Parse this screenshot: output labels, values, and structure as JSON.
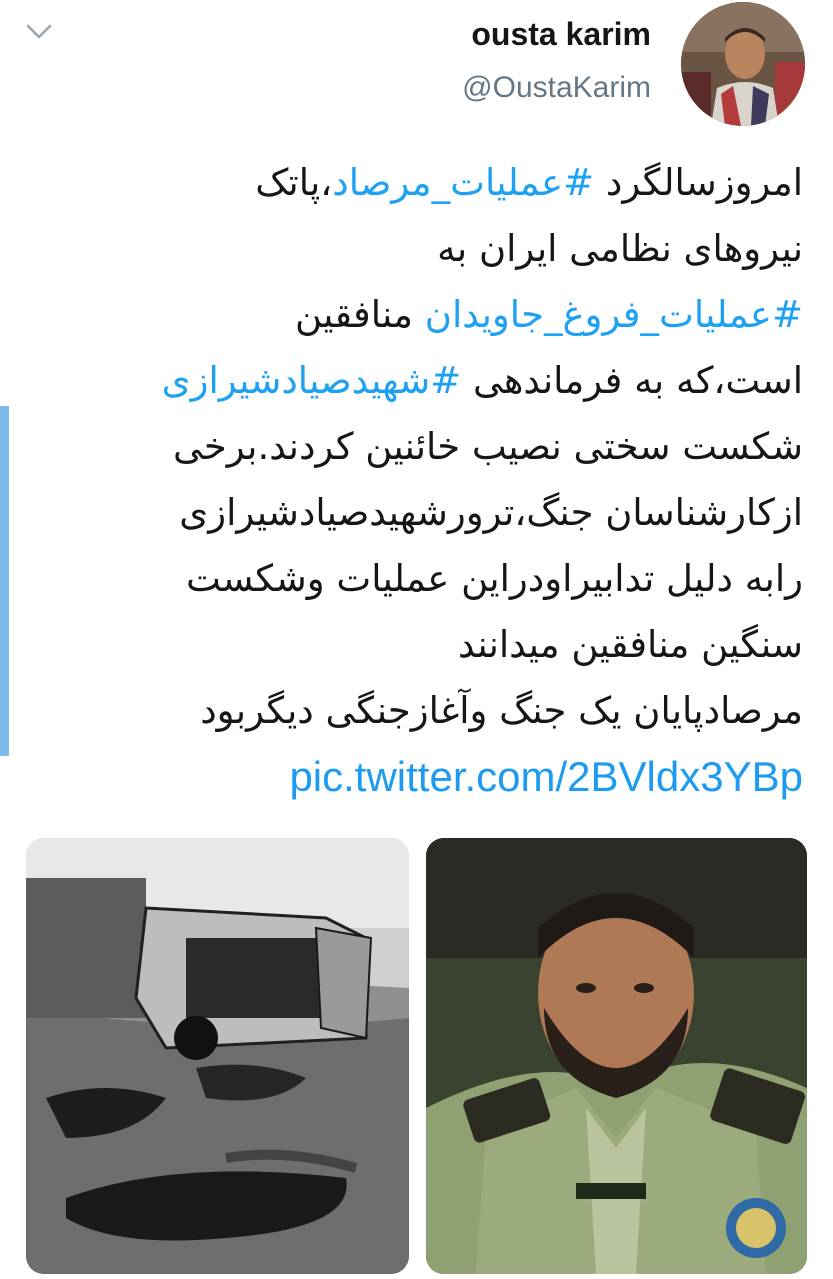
{
  "header": {
    "display_name": "ousta karim",
    "handle": "@OustaKarim",
    "menu_icon": "chevron-down-icon"
  },
  "tweet": {
    "lines": [
      [
        {
          "t": "امروزسالگرد "
        },
        {
          "t": "#عملیات_مرصاد",
          "tag": true
        },
        {
          "t": "،پاتک"
        }
      ],
      [
        {
          "t": "نیروهای نظامی ایران به"
        }
      ],
      [
        {
          "t": "#عملیات_فروغ_جاویدان",
          "tag": true
        },
        {
          "t": " منافقین"
        }
      ],
      [
        {
          "t": "است،که به فرماندهی "
        },
        {
          "t": "#شهیدصیادشیرازی",
          "tag": true
        }
      ],
      [
        {
          "t": "شکست سختی نصیب خائنین کردند.برخی"
        }
      ],
      [
        {
          "t": "ازکارشناسان جنگ،ترورشهیدصیادشیرازی"
        }
      ],
      [
        {
          "t": "رابه دلیل تدابیراودراین عملیات وشکست"
        }
      ],
      [
        {
          "t": "سنگین منافقین میدانند"
        }
      ],
      [
        {
          "t": "مرصادپایان یک جنگ وآغازجنگی دیگربود"
        }
      ]
    ],
    "link": "pic.twitter.com/2BVldx3YBp"
  },
  "colors": {
    "hashtag": "#1da1f2",
    "link": "#1d9bf0",
    "handle": "#657786",
    "accent_bar": "#7cbcec"
  }
}
